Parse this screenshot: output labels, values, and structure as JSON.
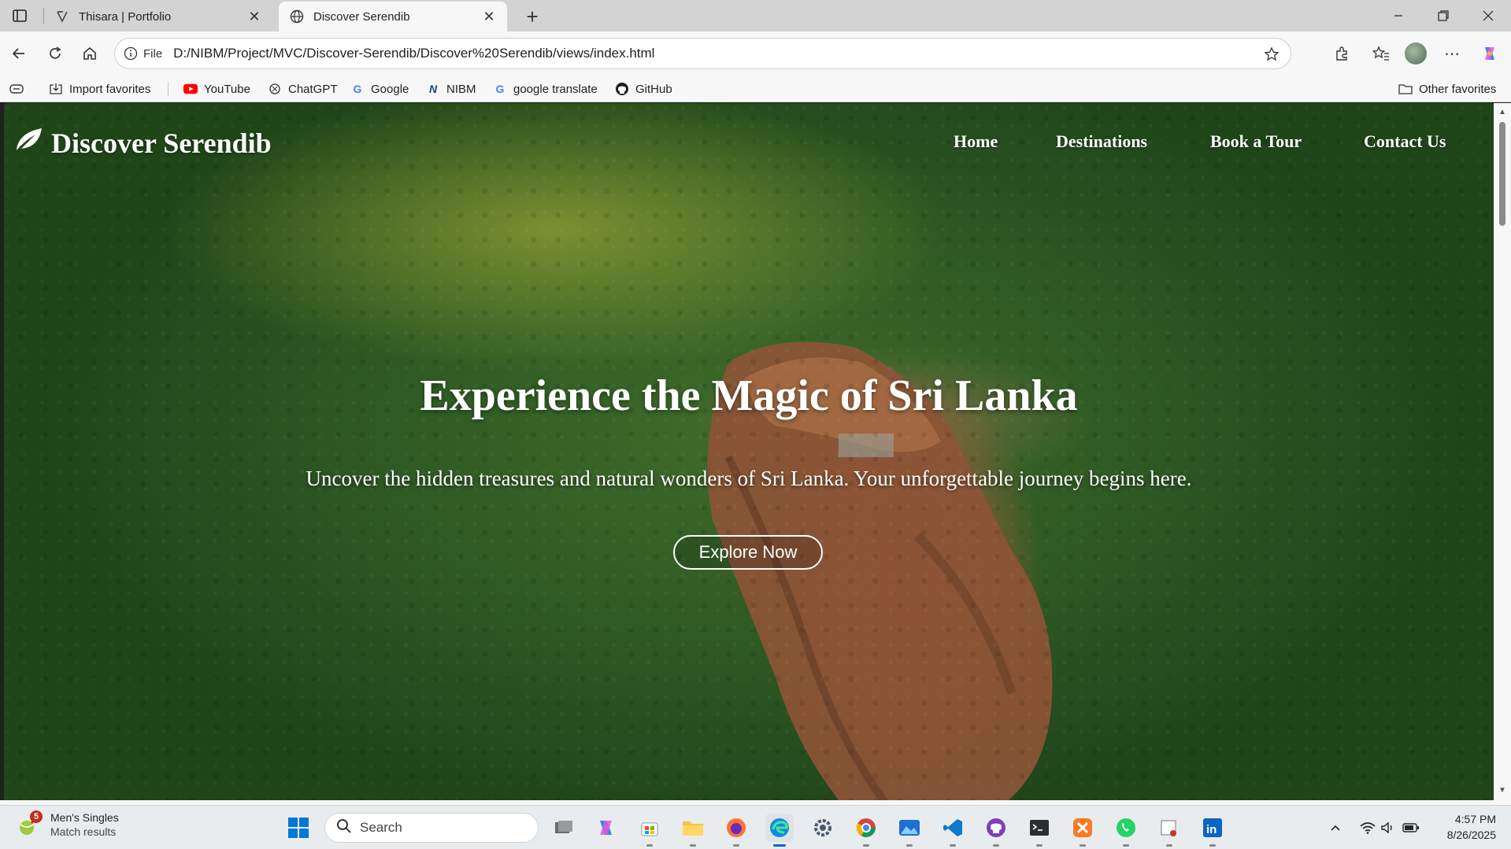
{
  "browser": {
    "tabs": [
      {
        "title": "Thisara | Portfolio",
        "active": false
      },
      {
        "title": "Discover Serendib",
        "active": true
      }
    ],
    "address": {
      "scheme": "File",
      "url": "D:/NIBM/Project/MVC/Discover-Serendib/Discover%20Serendib/views/index.html"
    },
    "favorites": [
      {
        "label": "Import favorites",
        "icon": "import-icon"
      },
      {
        "label": "YouTube",
        "icon": "youtube-icon"
      },
      {
        "label": "ChatGPT",
        "icon": "chatgpt-icon"
      },
      {
        "label": "Google",
        "icon": "google-icon"
      },
      {
        "label": "NIBM",
        "icon": "nibm-icon"
      },
      {
        "label": "google translate",
        "icon": "google-icon"
      },
      {
        "label": "GitHub",
        "icon": "github-icon"
      }
    ],
    "other_favorites": "Other favorites"
  },
  "page": {
    "logo_text": "Discover Serendib",
    "nav": [
      "Home",
      "Destinations",
      "Book a Tour",
      "Contact Us"
    ],
    "hero": {
      "title": "Experience the Magic of Sri Lanka",
      "subtitle": "Uncover the hidden treasures and natural wonders of Sri Lanka. Your unforgettable journey begins here.",
      "cta": "Explore Now"
    }
  },
  "taskbar": {
    "widget": {
      "title": "Men's Singles",
      "subtitle": "Match results",
      "badge": "5"
    },
    "search_placeholder": "Search",
    "time": "4:57 PM",
    "date": "8/26/2025"
  },
  "colors": {
    "accent": "#0067c0",
    "youtube": "#ff0000",
    "hero_text": "#ffffff"
  }
}
